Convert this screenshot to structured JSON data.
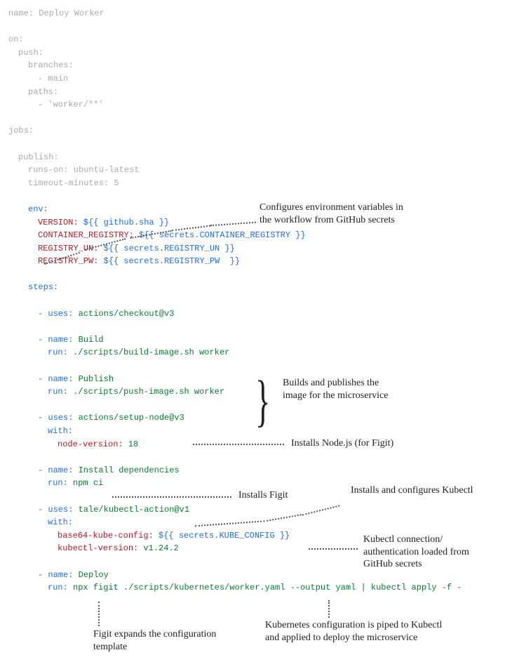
{
  "header": {
    "name_key": "name:",
    "name_val": " Deploy Worker",
    "on": "on:",
    "push": "push:",
    "branches_key": "branches:",
    "branches_item": "- main",
    "paths_key": "paths:",
    "paths_item": "- 'worker/**'",
    "jobs": "jobs:"
  },
  "job": {
    "publish": "publish:",
    "runs_on_key": "runs-on:",
    "runs_on_val": " ubuntu-latest",
    "timeout_key": "timeout-minutes:",
    "timeout_val": " 5",
    "env_key": "env:",
    "env_version_key": "VERSION:",
    "env_version_val": " ${{ github.sha }}",
    "env_registry_key": "CONTAINER_REGISTRY:",
    "env_registry_val": " ${{ secrets.CONTAINER_REGISTRY }}",
    "env_un_key": "REGISTRY_UN:",
    "env_un_val": " ${{ secrets.REGISTRY_UN }}",
    "env_pw_key": "REGISTRY_PW:",
    "env_pw_val": " ${{ secrets.REGISTRY_PW  }}",
    "steps_key": "steps:"
  },
  "steps": {
    "s1_uses": "actions/checkout@v3",
    "s2_name": "Build",
    "s2_run": "./scripts/build-image.sh worker",
    "s3_name": "Publish",
    "s3_run": "./scripts/push-image.sh worker",
    "s4_uses": "actions/setup-node@v3",
    "s4_with": "with:",
    "s4_nodekey": "node-version:",
    "s4_nodeval": " 18",
    "s5_name": "Install dependencies",
    "s5_run": "npm ci",
    "s6_uses": "tale/kubectl-action@v1",
    "s6_with": "with:",
    "s6_cfgkey": "base64-kube-config:",
    "s6_cfgval": " ${{ secrets.KUBE_CONFIG }}",
    "s6_verkey": "kubectl-version:",
    "s6_verval": " v1.24.2",
    "s7_name": "Deploy",
    "s7_run": "npx figit ./scripts/kubernetes/worker.yaml --output yaml | kubectl apply -f -"
  },
  "tokens": {
    "dash_uses": "- uses: ",
    "dash_name": "- name: ",
    "run_key": "run: "
  },
  "annotations": {
    "a1": "Configures environment variables in the workflow from GitHub secrets",
    "a2": "Builds and publishes the image for the microservice",
    "a3": "Installs Node.js (for Figit)",
    "a4": "Installs Figit",
    "a5": "Installs and configures Kubectl",
    "a6": "Kubectl connection/ authentication loaded from GitHub secrets",
    "a7": "Figit expands the configuration template",
    "a8": "Kubernetes configuration is piped to Kubectl and applied to deploy the microservice"
  }
}
